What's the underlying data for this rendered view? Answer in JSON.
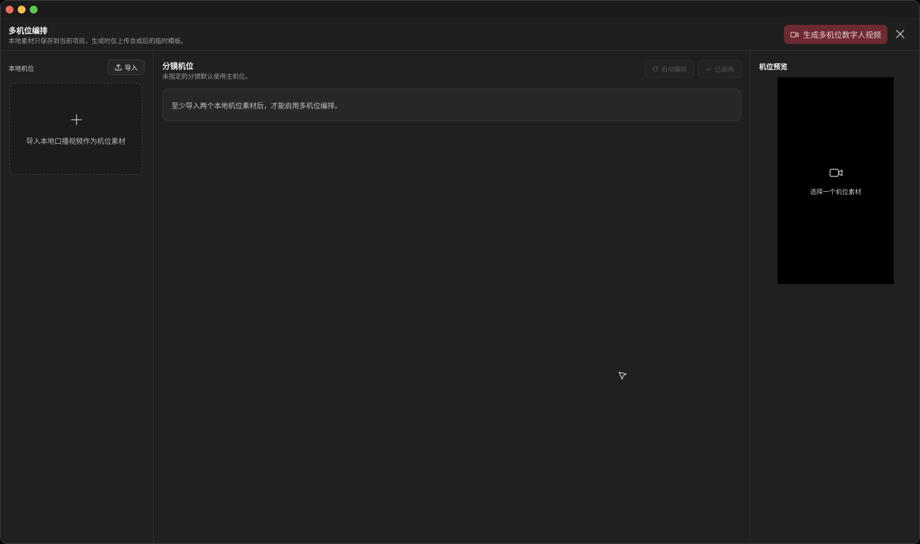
{
  "header": {
    "title": "多机位编排",
    "subtitle": "本地素材只保存到当前项目，生成时仅上传合成后的临时模板。",
    "generate_label": "生成多机位数字人视频"
  },
  "left": {
    "title": "本地机位",
    "import_label": "导入",
    "drop_text": "导入本地口播视频作为机位素材"
  },
  "middle": {
    "title": "分镜机位",
    "subtitle": "未指定的分镜默认使用主机位。",
    "auto_label": "自动编排",
    "enabled_label": "已启用",
    "notice": "至少导入两个本地机位素材后，才能启用多机位编排。"
  },
  "right": {
    "title": "机位预览",
    "preview_text": "选择一个机位素材"
  },
  "colors": {
    "accent": "#6e2a31",
    "background": "#202020"
  }
}
